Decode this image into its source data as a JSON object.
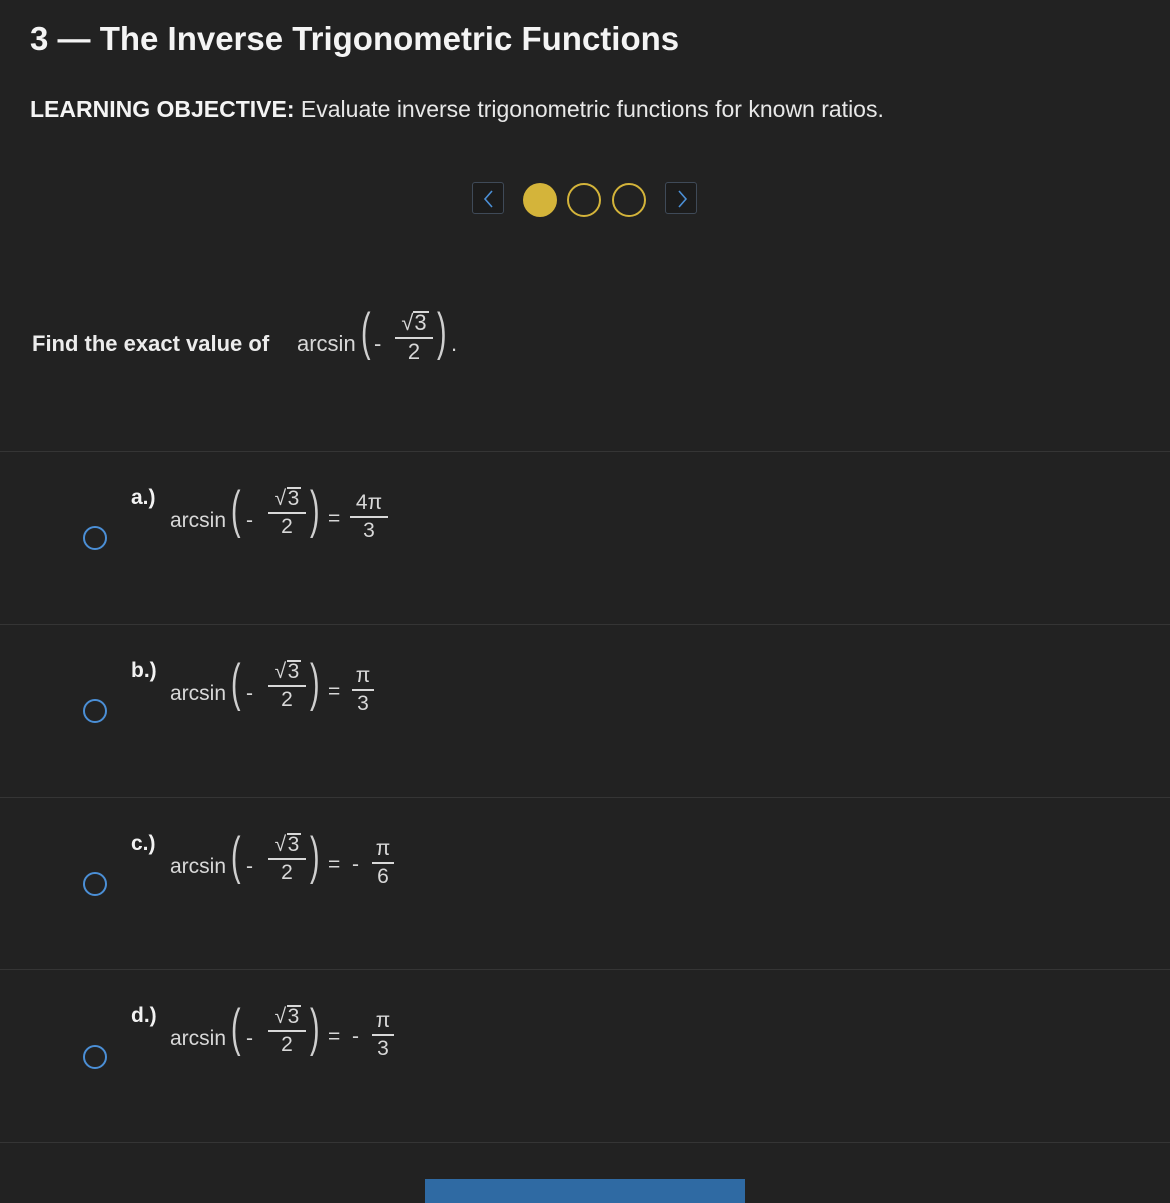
{
  "header": {
    "title": "3 — The Inverse Trigonometric Functions",
    "objective_label": "LEARNING OBJECTIVE:",
    "objective_text": " Evaluate inverse trigonometric functions for known ratios."
  },
  "pager": {
    "prev_icon": "chevron-left-icon",
    "next_icon": "chevron-right-icon",
    "dots": [
      {
        "state": "active"
      },
      {
        "state": "inactive"
      },
      {
        "state": "inactive"
      }
    ],
    "colors": {
      "accent": "#d4b43a",
      "arrow": "#4b8fd6"
    }
  },
  "question": {
    "prompt": "Find the exact value of ",
    "fn": "arcsin",
    "neg": "-",
    "num": "3",
    "den": "2",
    "period": "."
  },
  "options": [
    {
      "letter": "a.)",
      "fn": "arcsin",
      "neg": "-",
      "num": "3",
      "den": "2",
      "eq": "=",
      "rneg": "",
      "rnum": "4π",
      "rden": "3"
    },
    {
      "letter": "b.)",
      "fn": "arcsin",
      "neg": "-",
      "num": "3",
      "den": "2",
      "eq": "=",
      "rneg": "",
      "rnum": "π",
      "rden": "3"
    },
    {
      "letter": "c.)",
      "fn": "arcsin",
      "neg": "-",
      "num": "3",
      "den": "2",
      "eq": "=",
      "rneg": "-",
      "rnum": "π",
      "rden": "6"
    },
    {
      "letter": "d.)",
      "fn": "arcsin",
      "neg": "-",
      "num": "3",
      "den": "2",
      "eq": "=",
      "rneg": "-",
      "rnum": "π",
      "rden": "3"
    }
  ],
  "colors": {
    "background": "#222222",
    "radio": "#4b8fd6",
    "submit": "#2f6aa3"
  }
}
